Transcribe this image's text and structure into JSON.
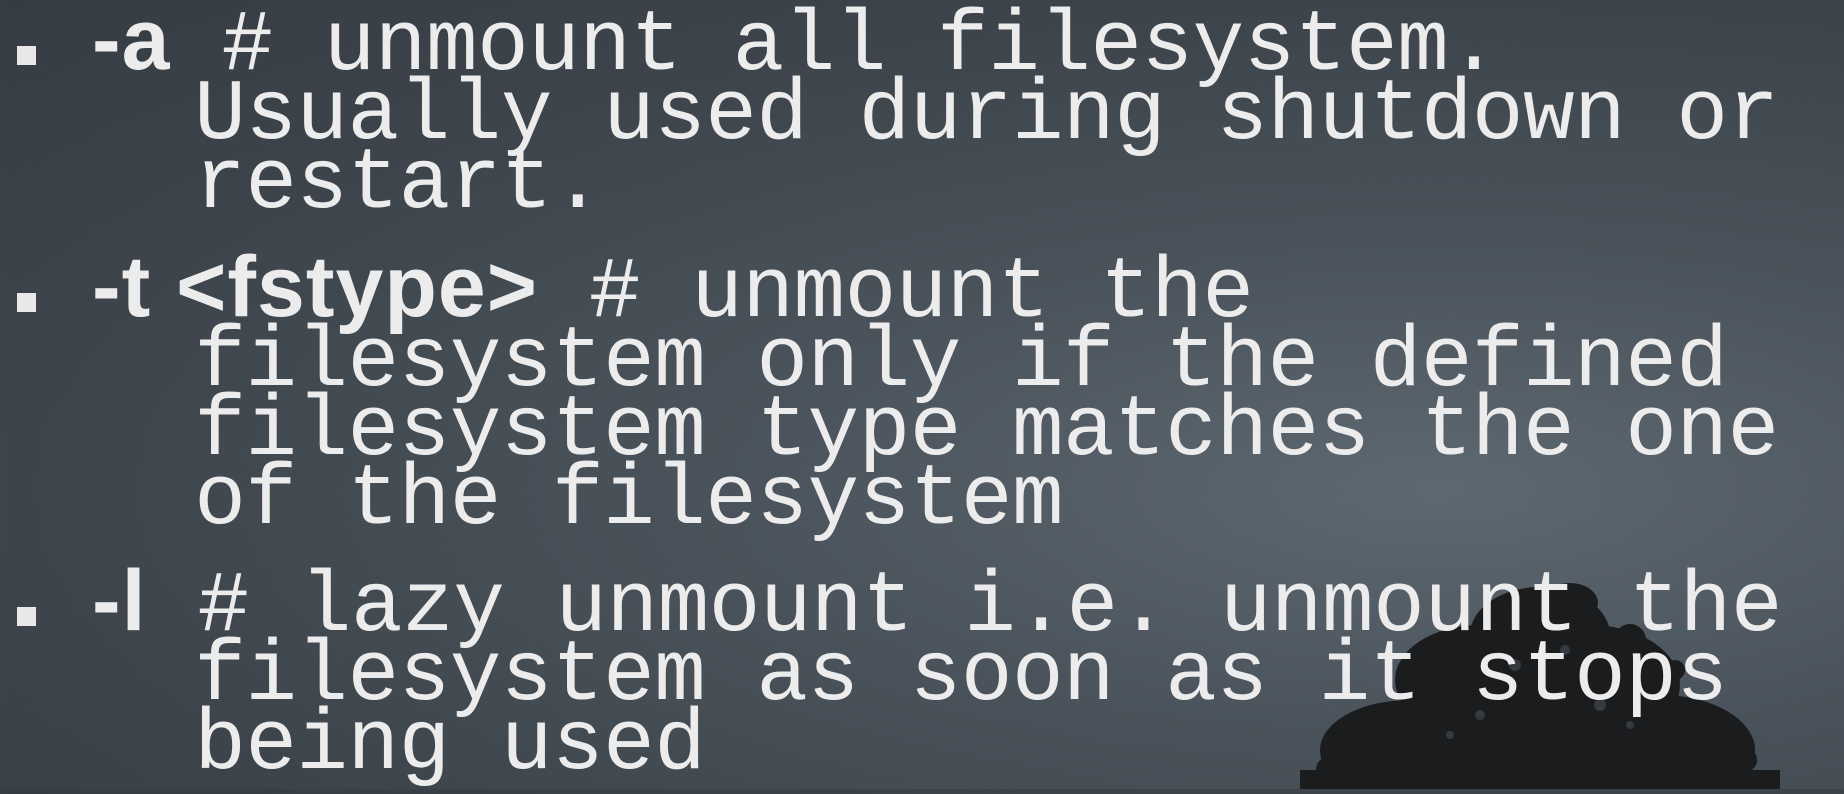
{
  "slide": {
    "items": [
      {
        "option": "-a",
        "line1": " # unmount all filesystem.",
        "line2": "Usually used during shutdown or",
        "line3": "restart."
      },
      {
        "option": "-t <fstype>",
        "line1": " # unmount the",
        "line2": "filesystem only if the defined",
        "line3": "filesystem type matches the one",
        "line4": "of the filesystem"
      },
      {
        "option": "-l",
        "line1": " # lazy unmount i.e. unmount the",
        "line2": "filesystem as soon as it stops",
        "line3": "being used"
      }
    ]
  },
  "colors": {
    "background": "#414950",
    "text": "#ececec",
    "tree": "#1a1c1e"
  },
  "decoration": {
    "icon": "tree-silhouette-icon"
  }
}
